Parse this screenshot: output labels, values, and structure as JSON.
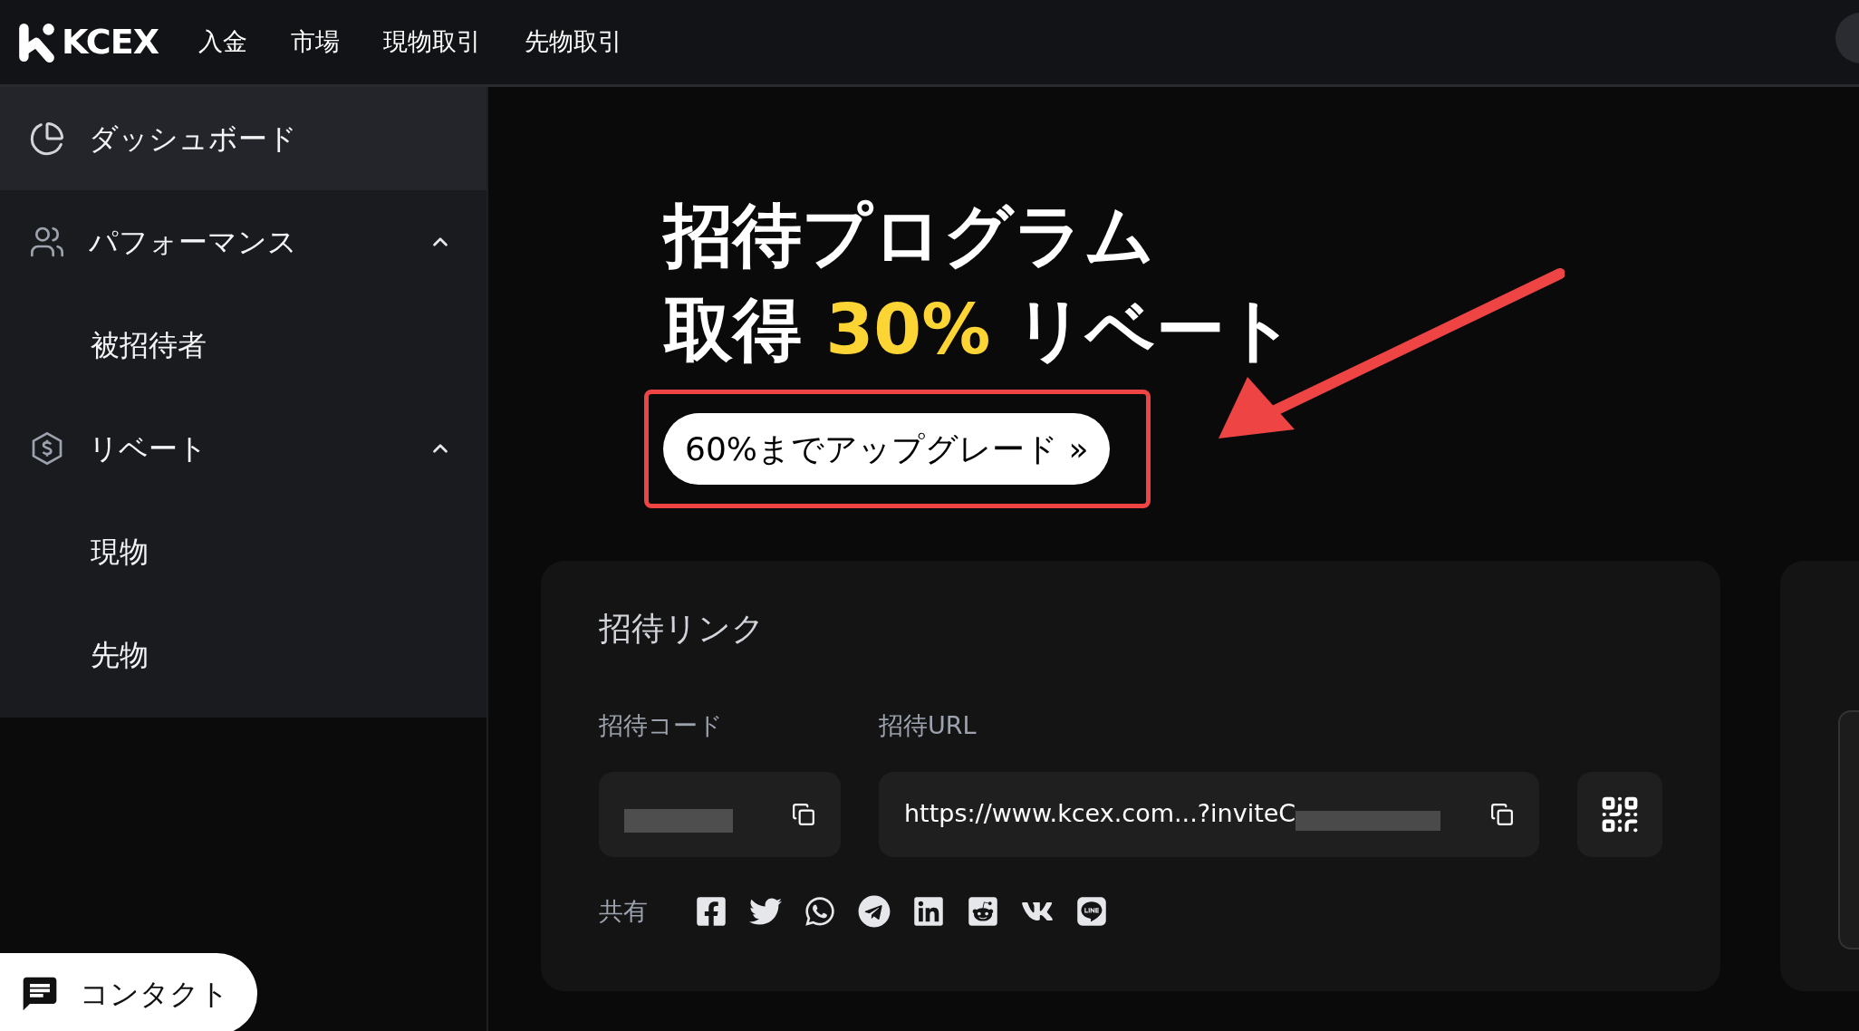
{
  "header": {
    "logo": "KCEX",
    "nav": [
      {
        "label": "入金"
      },
      {
        "label": "市場"
      },
      {
        "label": "現物取引"
      },
      {
        "label": "先物取引"
      }
    ]
  },
  "sidebar": {
    "items": [
      {
        "label": "ダッシュボード",
        "selected": true
      },
      {
        "label": "パフォーマンス",
        "selected": false,
        "expanded": true,
        "children": [
          {
            "label": "被招待者",
            "selected": false
          }
        ]
      },
      {
        "label": "リベート",
        "selected": false,
        "expanded": true,
        "children": [
          {
            "label": "現物",
            "selected": false
          },
          {
            "label": "先物",
            "selected": false
          }
        ]
      }
    ]
  },
  "hero": {
    "title": "招待プログラム",
    "subtitle_prefix": "取得",
    "subtitle_highlight": "30%",
    "subtitle_suffix": "リベート",
    "upgrade_button": "60%までアップグレード »"
  },
  "invite_card": {
    "title": "招待リンク",
    "code_label": "招待コード",
    "url_label": "招待URL",
    "url_value": "https://www.kcex.com...?inviteC",
    "share_label": "共有"
  },
  "contact_button": "コンタクト"
}
